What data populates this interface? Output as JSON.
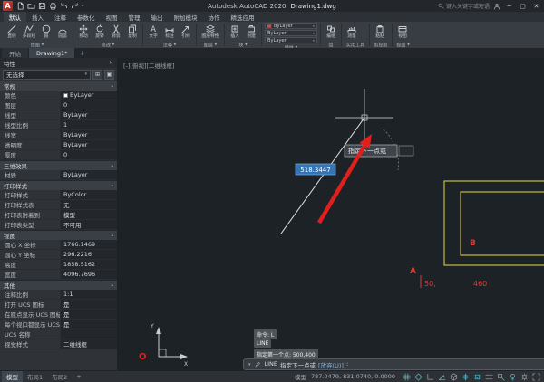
{
  "title_bar": {
    "logo_letter": "A",
    "quick_access": [
      {
        "name": "new",
        "icon": "doc"
      },
      {
        "name": "open",
        "icon": "folder"
      },
      {
        "name": "save",
        "icon": "save"
      },
      {
        "name": "plot",
        "icon": "print"
      },
      {
        "name": "undo",
        "icon": "undo"
      },
      {
        "name": "redo",
        "icon": "redo"
      }
    ],
    "app_title": "Autodesk AutoCAD 2020",
    "doc_title": "Drawing1.dwg",
    "search_placeholder": "键入关键字或短语",
    "window_controls": {
      "minimize": "─",
      "maximize": "▢",
      "close": "✕"
    }
  },
  "ribbon": {
    "tabs": [
      {
        "label": "默认",
        "active": true
      },
      {
        "label": "插入"
      },
      {
        "label": "注释"
      },
      {
        "label": "参数化"
      },
      {
        "label": "视图"
      },
      {
        "label": "管理"
      },
      {
        "label": "输出"
      },
      {
        "label": "附加模块"
      },
      {
        "label": "协作"
      },
      {
        "label": "精选应用"
      }
    ],
    "panels": [
      {
        "title": "绘图",
        "flyout": true,
        "items": [
          {
            "name": "line",
            "icon": "line",
            "label": "直线"
          },
          {
            "name": "polyline",
            "icon": "polyline",
            "label": "多段线"
          },
          {
            "name": "circle",
            "icon": "circle",
            "label": "圆"
          },
          {
            "name": "arc",
            "icon": "arc",
            "label": "圆弧"
          }
        ]
      },
      {
        "title": "修改",
        "flyout": true,
        "items": [
          {
            "name": "move",
            "icon": "move",
            "label": "移动"
          },
          {
            "name": "rotate",
            "icon": "rotate",
            "label": "旋转"
          },
          {
            "name": "trim",
            "icon": "trim",
            "label": "修剪"
          },
          {
            "name": "copy",
            "icon": "copy",
            "label": "复制"
          }
        ]
      },
      {
        "title": "注释",
        "flyout": true,
        "items": [
          {
            "name": "text",
            "icon": "text",
            "label": "文字"
          },
          {
            "name": "dimension",
            "icon": "dim",
            "label": "标注"
          },
          {
            "name": "leader",
            "icon": "leader",
            "label": "引线"
          }
        ]
      },
      {
        "title": "图层",
        "flyout": true,
        "items": [
          {
            "name": "layer-properties",
            "icon": "layers",
            "label": "图层特性"
          }
        ]
      },
      {
        "title": "块",
        "flyout": true,
        "items": [
          {
            "name": "insert-block",
            "icon": "insert",
            "label": "插入"
          },
          {
            "name": "create-block",
            "icon": "create",
            "label": "创建"
          }
        ]
      },
      {
        "title": "特性",
        "flyout": true,
        "bylayer_rows": [
          "ByLayer",
          "ByLayer",
          "ByLayer"
        ]
      },
      {
        "title": "组",
        "items": [
          {
            "name": "group",
            "icon": "group",
            "label": "编组"
          }
        ]
      },
      {
        "title": "实用工具",
        "items": [
          {
            "name": "measure",
            "icon": "measure",
            "label": "测量"
          }
        ]
      },
      {
        "title": "剪贴板",
        "items": [
          {
            "name": "paste",
            "icon": "paste",
            "label": "粘贴"
          }
        ]
      },
      {
        "title": "视图",
        "flyout": true,
        "items": [
          {
            "name": "view",
            "icon": "viewrect",
            "label": "视图"
          }
        ]
      }
    ]
  },
  "file_tabs": {
    "tabs": [
      {
        "label": "开始"
      },
      {
        "label": "Drawing1*",
        "active": true
      }
    ],
    "new_tab": "+"
  },
  "properties_palette": {
    "title": "特性",
    "close_glyph": "✕",
    "selection": "无选择",
    "dropdown_arrow": "▾",
    "buttons": [
      {
        "name": "toggle-pickadd",
        "glyph": "⊞"
      },
      {
        "name": "select-objects",
        "glyph": "▣"
      }
    ],
    "sections": [
      {
        "title": "常规",
        "rows": [
          {
            "label": "颜色",
            "value": "ByLayer",
            "swatch": "#ffffff"
          },
          {
            "label": "图层",
            "value": "0"
          },
          {
            "label": "线型",
            "value": "ByLayer"
          },
          {
            "label": "线型比例",
            "value": "1"
          },
          {
            "label": "线宽",
            "value": "ByLayer"
          },
          {
            "label": "透明度",
            "value": "ByLayer"
          },
          {
            "label": "厚度",
            "value": "0"
          }
        ]
      },
      {
        "title": "三维效果",
        "rows": [
          {
            "label": "材质",
            "value": "ByLayer"
          }
        ]
      },
      {
        "title": "打印样式",
        "rows": [
          {
            "label": "打印样式",
            "value": "ByColor"
          },
          {
            "label": "打印样式表",
            "value": "无"
          },
          {
            "label": "打印表附着到",
            "value": "模型"
          },
          {
            "label": "打印表类型",
            "value": "不可用"
          }
        ]
      },
      {
        "title": "视图",
        "rows": [
          {
            "label": "圆心 X 坐标",
            "value": "1766.1469"
          },
          {
            "label": "圆心 Y 坐标",
            "value": "296.2216"
          },
          {
            "label": "高度",
            "value": "1858.5162"
          },
          {
            "label": "宽度",
            "value": "4096.7696"
          }
        ]
      },
      {
        "title": "其他",
        "rows": [
          {
            "label": "注释比例",
            "value": "1:1"
          },
          {
            "label": "打开 UCS 图标",
            "value": "是"
          },
          {
            "label": "在原点显示 UCS 图标",
            "value": "是"
          },
          {
            "label": "每个视口都显示 UCS 图标",
            "value": "是"
          },
          {
            "label": "UCS 名称",
            "value": ""
          },
          {
            "label": "视觉样式",
            "value": "二维线框"
          }
        ]
      }
    ]
  },
  "drawing": {
    "viewport_controls": "[-][俯视][二维线框]",
    "dynamic_dim_value": "518.3447",
    "tooltip_text": "指定下一点或",
    "ucs_x_label": "X",
    "ucs_y_label": "Y",
    "origin_label": "O",
    "label_a": "A",
    "label_b": "B",
    "red_value_1": "50,",
    "red_value_2": "460",
    "history_lines": [
      "命令: L",
      "LINE",
      "指定第一个点: 500,400"
    ],
    "command_bar": {
      "command": "LINE",
      "prompt": "指定下一点或",
      "option": "[放弃(U)]",
      "colon": ":"
    }
  },
  "status_bar": {
    "layout_tabs": [
      {
        "label": "模型",
        "active": true
      },
      {
        "label": "布局1"
      },
      {
        "label": "布局2"
      },
      {
        "label": "+"
      }
    ],
    "space_toggle": "模型",
    "coordinates": "787.0479, 831.0740, 0.0000",
    "toggles": [
      {
        "name": "grid-display",
        "icon": "grid",
        "active": true
      },
      {
        "name": "snap-mode",
        "icon": "snap",
        "active": true
      },
      {
        "name": "ortho-mode",
        "icon": "ortho",
        "active": false
      },
      {
        "name": "polar-tracking",
        "icon": "polar",
        "active": true
      },
      {
        "name": "isometric-drafting",
        "icon": "iso",
        "active": false
      },
      {
        "name": "object-snap-tracking",
        "icon": "otrack",
        "active": true
      },
      {
        "name": "object-snap",
        "icon": "osnap",
        "active": true
      },
      {
        "name": "lineweight-display",
        "icon": "lwt",
        "active": false
      },
      {
        "name": "dynamic-input",
        "icon": "dyn",
        "active": true
      },
      {
        "name": "annotation-visibility",
        "icon": "anno",
        "active": true
      },
      {
        "name": "workspace-settings",
        "icon": "gear",
        "active": false
      },
      {
        "name": "clean-screen",
        "icon": "clean",
        "active": false
      }
    ]
  },
  "colors": {
    "annotation_red": "#e0201d",
    "highlight_blue": "#3574b5",
    "rect_yellow": "#d6c73e",
    "status_active_teal": "#4fb3c9"
  }
}
